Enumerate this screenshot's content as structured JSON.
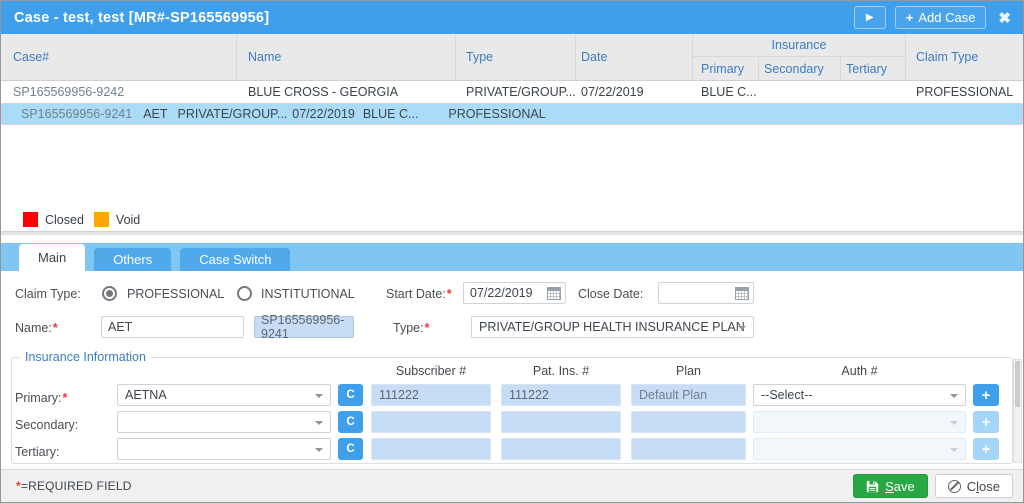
{
  "titlebar": {
    "title": "Case - test, test [MR#-SP165569956]",
    "play_icon": "▶",
    "add_icon": "+",
    "add_case_label": "Add Case",
    "close_icon": "✖"
  },
  "table": {
    "headers": {
      "case": "Case#",
      "name": "Name",
      "type": "Type",
      "date": "Date",
      "insurance_group": "Insurance",
      "primary": "Primary",
      "secondary": "Secondary",
      "tertiary": "Tertiary",
      "claim_type": "Claim Type"
    },
    "rows": [
      {
        "case_number": "SP165569956-9242",
        "name": "BLUE CROSS - GEORGIA",
        "type": "PRIVATE/GROUP...",
        "date": "07/22/2019",
        "primary": "BLUE C...",
        "secondary": "",
        "tertiary": "",
        "claim_type": "PROFESSIONAL"
      },
      {
        "case_number": "SP165569956-9241",
        "name": "AET",
        "type": "PRIVATE/GROUP...",
        "date": "07/22/2019",
        "primary": "BLUE C...",
        "secondary": "",
        "tertiary": "",
        "claim_type": "PROFESSIONAL"
      }
    ]
  },
  "legend": {
    "closed_label": "Closed",
    "void_label": "Void",
    "closed_color": "#fe0000",
    "void_color": "#ffa700"
  },
  "tabs": {
    "main": "Main",
    "others": "Others",
    "case_switch": "Case Switch"
  },
  "form": {
    "required_marker": "*",
    "claim_type_label": "Claim Type:",
    "radio_professional": "PROFESSIONAL",
    "radio_institutional": "INSTITUTIONAL",
    "start_date_label": "Start Date:",
    "start_date_value": "07/22/2019",
    "close_date_label": "Close Date:",
    "close_date_value": "",
    "name_label": "Name:",
    "name_value": "AET",
    "case_number_value": "SP165569956-9241",
    "type_label": "Type:",
    "type_value": "PRIVATE/GROUP HEALTH INSURANCE PLAN"
  },
  "insurance": {
    "section_title": "Insurance Information",
    "columns": {
      "subscriber": "Subscriber #",
      "pat_ins": "Pat. Ins. #",
      "plan": "Plan",
      "auth": "Auth #"
    },
    "c_button": "C",
    "add_button": "+",
    "rows": [
      {
        "label": "Primary:",
        "carrier": "AETNA",
        "subscriber": "111222",
        "pat_ins": "111222",
        "plan": "Default Plan",
        "auth": "--Select--"
      },
      {
        "label": "Secondary:",
        "carrier": "",
        "subscriber": "",
        "pat_ins": "",
        "plan": "",
        "auth": ""
      },
      {
        "label": "Tertiary:",
        "carrier": "",
        "subscriber": "",
        "pat_ins": "",
        "plan": "",
        "auth": ""
      }
    ]
  },
  "footer": {
    "required_star": "*",
    "required_note": "=REQUIRED FIELD",
    "save_key": "S",
    "save_rest": "ave",
    "close_pre": "C",
    "close_key": "l",
    "close_rest": "ose"
  },
  "colors": {
    "titlebar_blue": "#3f9fea",
    "selected_row_blue": "#aadcf7",
    "tab_strip_blue": "#7fc6f3",
    "tab_inactive_blue": "#4fa9eb",
    "save_green": "#28a745",
    "header_text_blue": "#3c7dc1"
  }
}
